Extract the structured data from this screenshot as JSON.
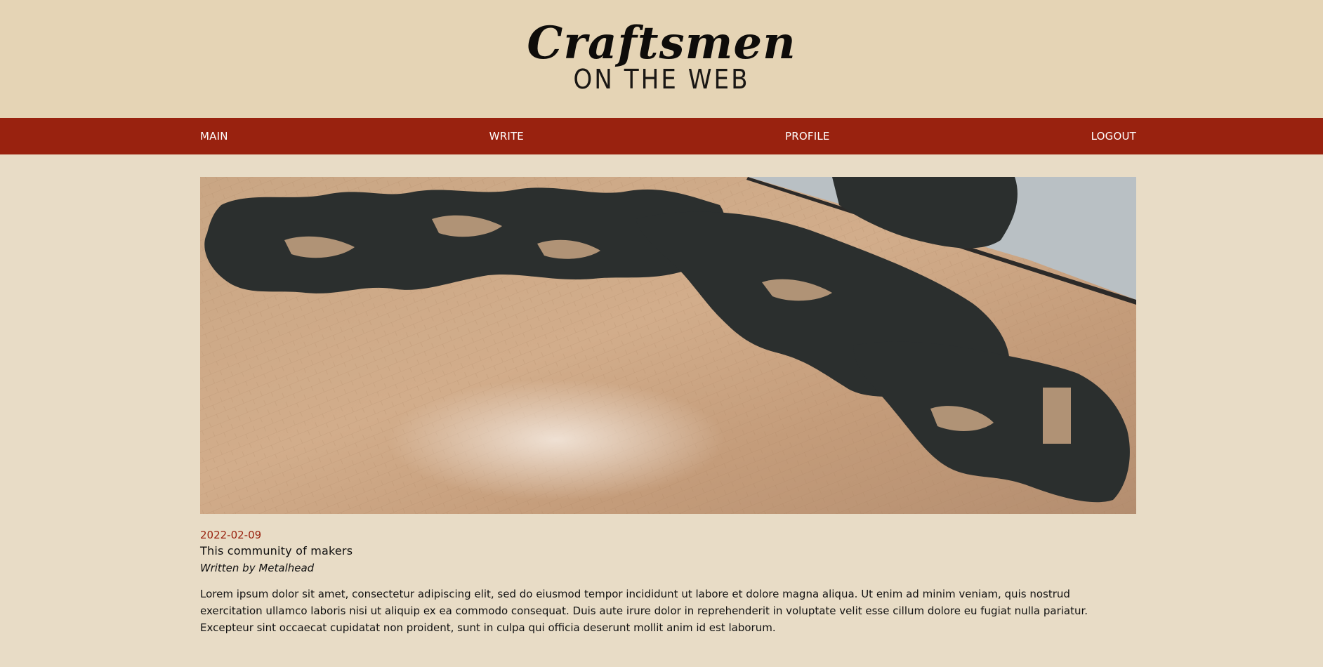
{
  "site": {
    "title": "Craftsmen",
    "subtitle": "ON THE WEB"
  },
  "nav": {
    "items": [
      {
        "label": "MAIN"
      },
      {
        "label": "WRITE"
      },
      {
        "label": "PROFILE"
      },
      {
        "label": "LOGOUT"
      }
    ]
  },
  "post": {
    "date": "2022-02-09",
    "title": "This community of makers",
    "author": "Written by Metalhead",
    "body": "Lorem ipsum dolor sit amet, consectetur adipiscing elit, sed do eiusmod tempor incididunt ut labore et dolore magna aliqua. Ut enim ad minim veniam, quis nostrud exercitation ullamco laboris nisi ut aliquip ex ea commodo consequat. Duis aute irure dolor in reprehenderit in voluptate velit esse cillum dolore eu fugiat nulla pariatur. Excepteur sint occaecat cupidatat non proident, sunt in culpa qui officia deserunt mollit anim id est laborum."
  },
  "colors": {
    "banner": "#e5d4b5",
    "background": "#e8dcc6",
    "nav": "#99220f",
    "accent": "#99220f"
  }
}
